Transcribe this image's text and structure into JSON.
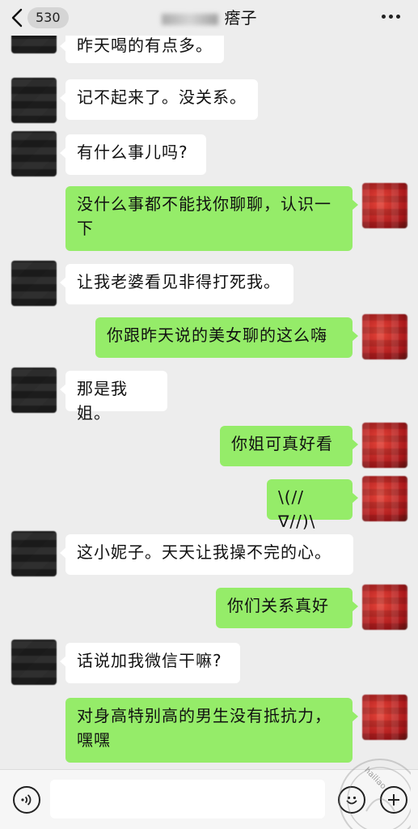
{
  "header": {
    "back_count": "530",
    "title": "瘩子",
    "back_icon": "chevron-left-icon",
    "more_icon": "more-dots-icon"
  },
  "messages": [
    {
      "side": "left",
      "text": "昨天喝的有点多。"
    },
    {
      "side": "left",
      "text": "记不起来了。没关系。"
    },
    {
      "side": "left",
      "text": "有什么事儿吗?"
    },
    {
      "side": "right",
      "text": "没什么事都不能找你聊聊，认识一下"
    },
    {
      "side": "left",
      "text": "让我老婆看见非得打死我。"
    },
    {
      "side": "right",
      "text": "你跟昨天说的美女聊的这么嗨"
    },
    {
      "side": "left",
      "text": "那是我姐。"
    },
    {
      "side": "right",
      "text": "你姐可真好看"
    },
    {
      "side": "right",
      "text": "\\(//∇//)\\"
    },
    {
      "side": "left",
      "text": "这小妮子。天天让我操不完的心。"
    },
    {
      "side": "right",
      "text": "你们关系真好"
    },
    {
      "side": "left",
      "text": "话说加我微信干嘛?"
    },
    {
      "side": "right",
      "text": "对身高特别高的男生没有抵抗力，嘿嘿"
    }
  ],
  "input_bar": {
    "input_value": "",
    "voice_icon": "voice-icon",
    "emoji_icon": "emoji-icon",
    "add_icon": "add-icon"
  },
  "watermark": {
    "text": "hailiao"
  },
  "colors": {
    "background": "#ededed",
    "self_bubble": "#95ec69",
    "other_bubble": "#ffffff"
  }
}
